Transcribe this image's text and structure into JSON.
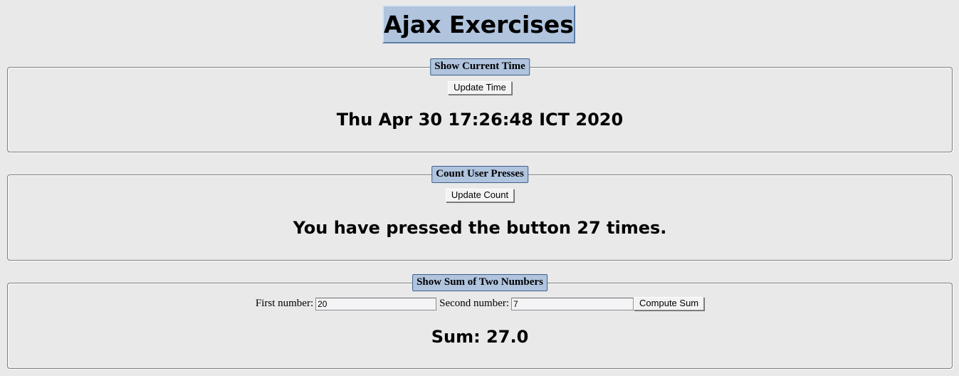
{
  "page": {
    "title": "Ajax Exercises"
  },
  "time_section": {
    "legend": "Show Current Time",
    "button_label": "Update Time",
    "result": "Thu Apr 30 17:26:48 ICT 2020"
  },
  "count_section": {
    "legend": "Count User Presses",
    "button_label": "Update Count",
    "result": "You have pressed the button 27 times."
  },
  "sum_section": {
    "legend": "Show Sum of Two Numbers",
    "first_label": "First number:",
    "first_value": "20",
    "second_label": "Second number:",
    "second_value": "7",
    "button_label": "Compute Sum",
    "result": "Sum: 27.0"
  },
  "colors": {
    "background": "#e9e9e9",
    "legend_fill": "#b0c4de",
    "legend_border": "#3d5f8a"
  }
}
